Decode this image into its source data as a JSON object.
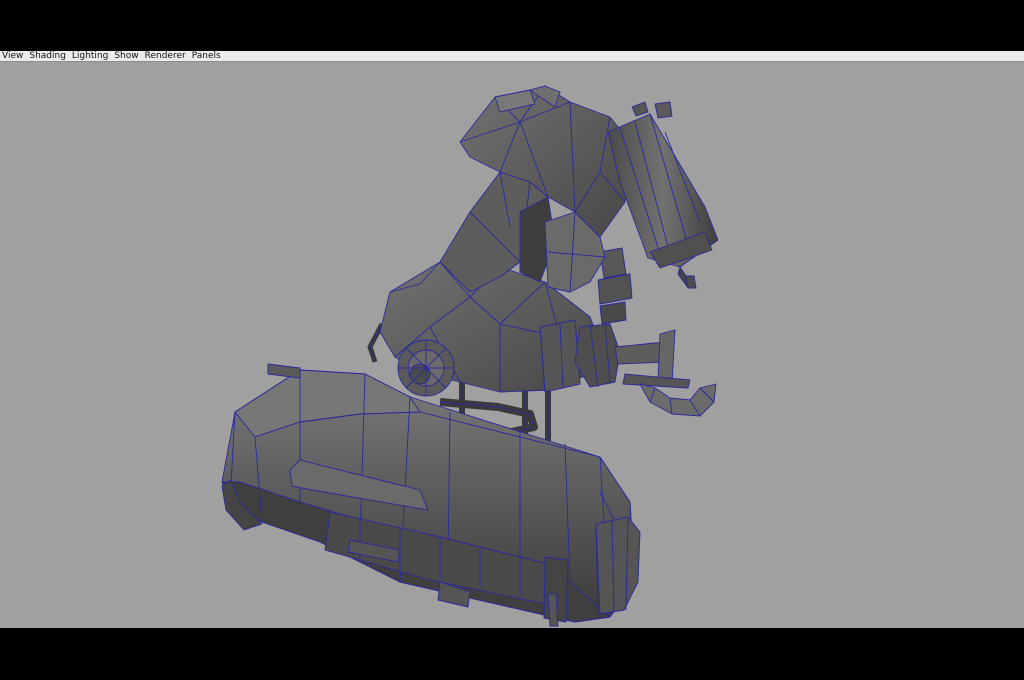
{
  "menubar": {
    "items": [
      {
        "label": "View"
      },
      {
        "label": "Shading"
      },
      {
        "label": "Lighting"
      },
      {
        "label": "Show"
      },
      {
        "label": "Renderer"
      },
      {
        "label": "Panels"
      }
    ]
  },
  "viewport": {
    "background_color": "#a0a0a0",
    "wireframe_color": "#2a2a9a",
    "model_color": "#5e5e5e"
  }
}
